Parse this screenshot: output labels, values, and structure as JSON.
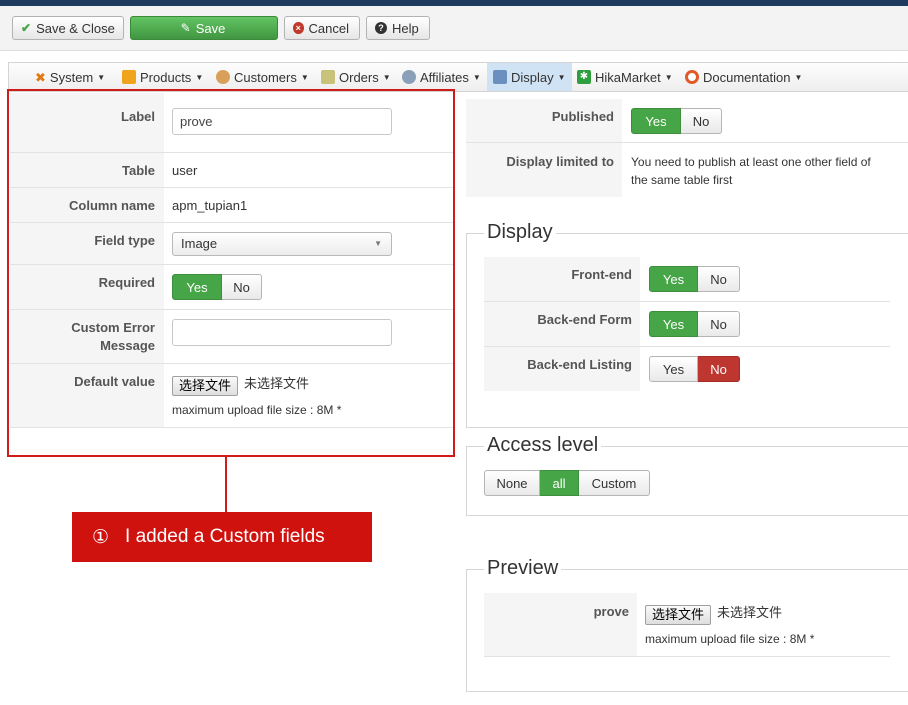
{
  "toolbar": {
    "save_close": "Save & Close",
    "save": "Save",
    "cancel": "Cancel",
    "help": "Help"
  },
  "menu": [
    {
      "label": "System",
      "icon": "wrench-icon"
    },
    {
      "label": "Products",
      "icon": "products-icon"
    },
    {
      "label": "Customers",
      "icon": "customers-icon"
    },
    {
      "label": "Orders",
      "icon": "orders-icon"
    },
    {
      "label": "Affiliates",
      "icon": "affiliates-icon"
    },
    {
      "label": "Display",
      "icon": "display-icon"
    },
    {
      "label": "HikaMarket",
      "icon": "hikamarket-icon"
    },
    {
      "label": "Documentation",
      "icon": "documentation-icon"
    }
  ],
  "form": {
    "label_label": "Label",
    "label_value": "prove",
    "table_label": "Table",
    "table_value": "user",
    "column_label": "Column name",
    "column_value": "apm_tupian1",
    "fieldtype_label": "Field type",
    "fieldtype_value": "Image",
    "required_label": "Required",
    "required_yes": "Yes",
    "required_no": "No",
    "error_label_1": "Custom Error",
    "error_label_2": "Message",
    "error_value": "",
    "default_label": "Default value",
    "file_button": "选择文件",
    "file_none": "未选择文件",
    "upload_hint": "maximum upload file size : 8M *"
  },
  "right": {
    "published_label": "Published",
    "published_yes": "Yes",
    "published_no": "No",
    "limited_label": "Display limited to",
    "limited_line1": "You need to publish at least one other field of",
    "limited_line2": "the same table first"
  },
  "display_section": {
    "legend": "Display",
    "frontend_label": "Front-end",
    "backend_form_label": "Back-end Form",
    "backend_listing_label": "Back-end Listing",
    "yes": "Yes",
    "no": "No"
  },
  "access_section": {
    "legend": "Access level",
    "none": "None",
    "all": "all",
    "custom": "Custom"
  },
  "preview_section": {
    "legend": "Preview",
    "field_label": "prove",
    "file_button": "选择文件",
    "file_none": "未选择文件",
    "upload_hint": "maximum upload file size : 8M *"
  },
  "annotation": {
    "number": "①",
    "text": "I added a Custom fields"
  },
  "colors": {
    "green": "#46a546",
    "red": "#bd362f",
    "annotation_red": "#d0120f"
  }
}
